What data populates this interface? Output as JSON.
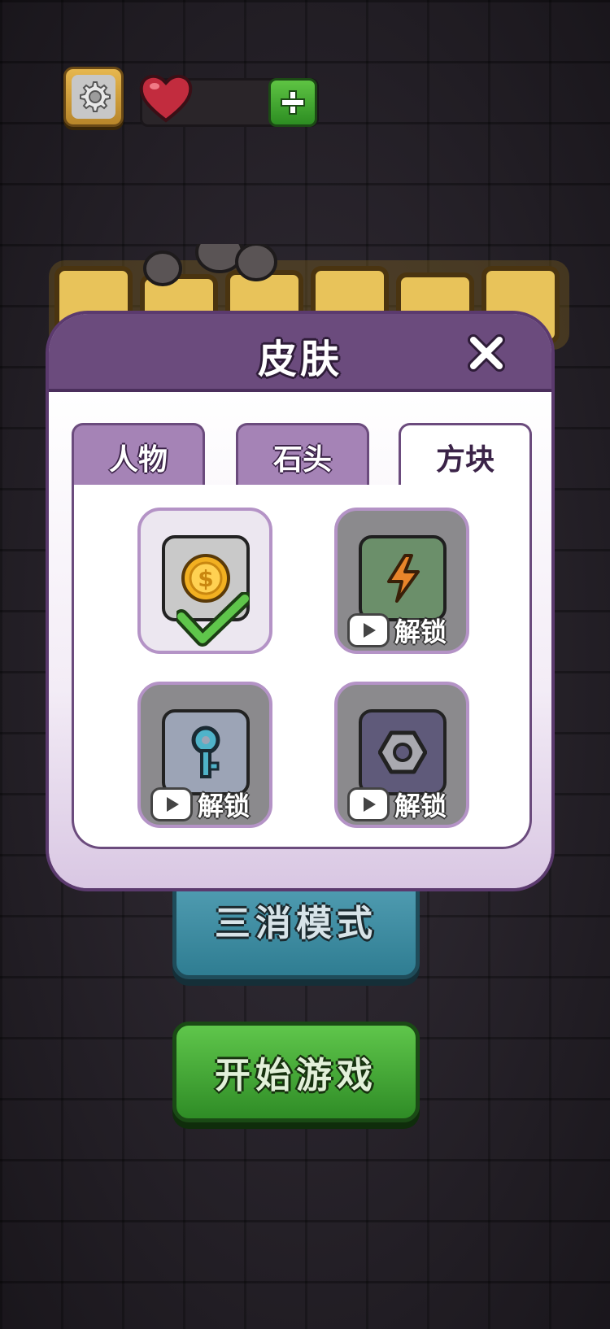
{
  "modal": {
    "title": "皮肤",
    "tabs": [
      {
        "label": "人物",
        "active": false
      },
      {
        "label": "石头",
        "active": false
      },
      {
        "label": "方块",
        "active": true
      }
    ],
    "skins": [
      {
        "name": "coin-block",
        "state": "selected",
        "icon": "coin-icon"
      },
      {
        "name": "lightning-block",
        "state": "locked",
        "unlock_label": "解锁",
        "icon": "lightning-icon"
      },
      {
        "name": "key-block",
        "state": "locked",
        "unlock_label": "解锁",
        "icon": "key-icon"
      },
      {
        "name": "nut-block",
        "state": "locked",
        "unlock_label": "解锁",
        "icon": "nut-icon"
      }
    ]
  },
  "buttons": {
    "match3_label": "三消模式",
    "start_label": "开始游戏"
  },
  "colors": {
    "modal_header": "#6b4b7d",
    "tab_inactive": "#a583b6",
    "start_green": "#2f8c26",
    "match3_blue": "#2f7d92"
  }
}
